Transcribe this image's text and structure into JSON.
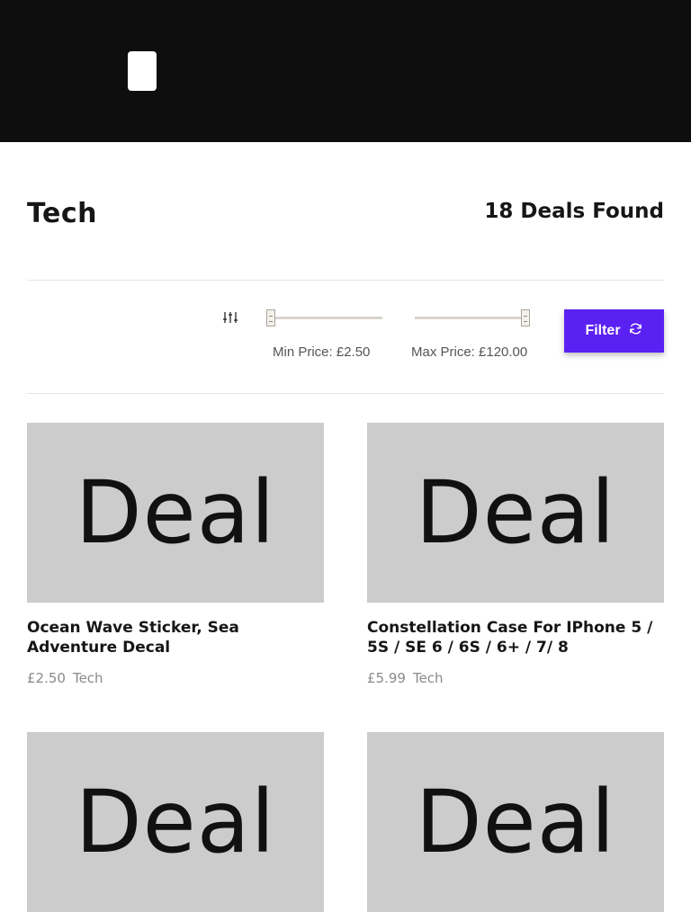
{
  "header": {
    "logo_icon": "app-logo-icon"
  },
  "page": {
    "title": "Tech",
    "deal_count": "18 Deals Found"
  },
  "filters": {
    "icon": "sliders-icon",
    "min_label": "Min Price: £2.50",
    "max_label": "Max Price: £120.00",
    "min_value": 2.5,
    "max_value": 120,
    "button_label": "Filter",
    "button_icon": "refresh-icon",
    "accent": "#5b21f2"
  },
  "deals": [
    {
      "image_text": "Deal",
      "title": "Ocean Wave Sticker, Sea Adventure Decal",
      "price": "£2.50",
      "category": "Tech"
    },
    {
      "image_text": "Deal",
      "title": "Constellation Case For IPhone 5 / 5S / SE 6 / 6S / 6+ / 7/ 8",
      "price": "£5.99",
      "category": "Tech"
    },
    {
      "image_text": "Deal"
    },
    {
      "image_text": "Deal"
    }
  ]
}
